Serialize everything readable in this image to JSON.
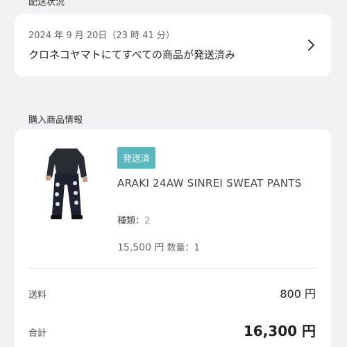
{
  "delivery": {
    "section_title": "配送状況",
    "date": "2024 年 9 月 20日（23 時 41 分）",
    "status": "クロネコヤマトにてすべての商品が発送済み"
  },
  "purchase": {
    "section_title": "購入商品情報",
    "status_badge": "発送済",
    "product_name": "ARAKI 24AW SINREI SWEAT PANTS",
    "variant_label": "種類：",
    "variant_value": "2",
    "price": "15,500 円",
    "quantity": "数量：1",
    "shipping_label": "送料",
    "shipping_value": "800 円",
    "total_label": "合計",
    "total_value": "16,300 円"
  },
  "colors": {
    "badge": "#5bb7bf",
    "background": "#f2f2f4"
  },
  "icons": {
    "chevron": "chevron-right-icon"
  }
}
